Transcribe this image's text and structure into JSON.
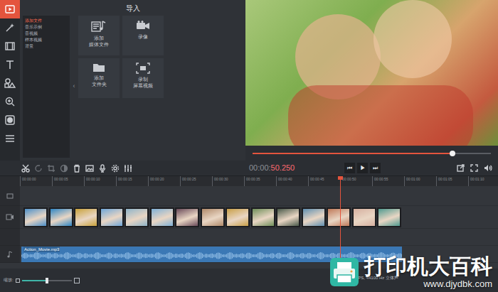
{
  "tools": [
    {
      "selected": true
    },
    {
      "selected": false
    },
    {
      "selected": false
    },
    {
      "selected": false
    },
    {
      "selected": false
    },
    {
      "selected": false
    },
    {
      "selected": false
    },
    {
      "selected": false
    }
  ],
  "import_panel": {
    "title": "导入",
    "categories": [
      {
        "label": "添加文件",
        "selected": true
      },
      {
        "label": "音乐示例",
        "selected": false
      },
      {
        "label": "音视频",
        "selected": false
      },
      {
        "label": "样本视频",
        "selected": false
      },
      {
        "label": "背景",
        "selected": false
      }
    ],
    "collapse": "‹",
    "tiles": [
      {
        "label": "添加\n媒体文件"
      },
      {
        "label": "录像"
      },
      {
        "label": "添加\n文件夹"
      },
      {
        "label": "录制\n屏幕视频"
      }
    ]
  },
  "player": {
    "level": 0.84,
    "time": {
      "elapsed": "00:00:",
      "current": "50.250"
    },
    "transport": [
      "⏮",
      "▶",
      "⏭"
    ]
  },
  "timeline": {
    "ruler": [
      "00:00:00",
      "00:00:05",
      "00:00:10",
      "00:00:15",
      "00:00:20",
      "00:00:25",
      "00:00:30",
      "00:00:35",
      "00:00:40",
      "00:00:45",
      "00:00:50",
      "00:00:55",
      "00:01:00",
      "00:01:05",
      "00:01:10"
    ],
    "playhead": {
      "level": 0.67
    },
    "clips": [
      {
        "color": "#4b8fc9"
      },
      {
        "color": "#2f86c4"
      },
      {
        "color": "#c9a23b"
      },
      {
        "color": "#6fa6d8"
      },
      {
        "color": "#8fb4c9"
      },
      {
        "color": "#7fb0d6"
      },
      {
        "color": "#6a4b5a"
      },
      {
        "color": "#b08a6a"
      },
      {
        "color": "#c9a048"
      },
      {
        "color": "#6f8f5a"
      },
      {
        "color": "#4a5a4a"
      },
      {
        "color": "#5f8fb0"
      },
      {
        "color": "#c07a5a"
      },
      {
        "color": "#d6b0a0"
      },
      {
        "color": "#4f9a8f"
      }
    ],
    "audio": {
      "label": "Action_Movie.mp3"
    }
  },
  "zoom": {
    "label": "缩放:",
    "level": 0.5
  },
  "status": "29.97 FPS, 44100 Hz 立体声",
  "watermark": {
    "title": "打印机大百科",
    "url": "www.djydbk.com"
  }
}
